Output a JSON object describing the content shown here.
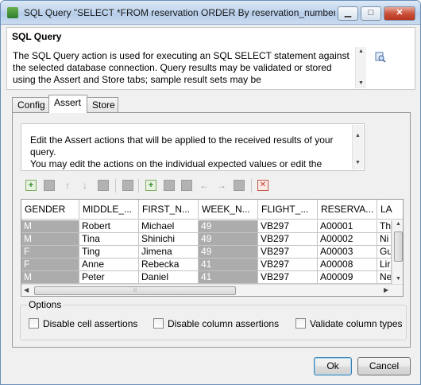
{
  "window": {
    "title": "SQL Query \"SELECT *FROM reservation  ORDER By reservation_number\" ...",
    "minimize_label": "▁",
    "maximize_label": "□",
    "close_label": "✕"
  },
  "header": {
    "title": "SQL Query",
    "description": "The SQL Query action is used for executing an SQL SELECT statement against the selected database connection. Query results may be validated or stored using the Assert and Store tabs; sample result sets may be"
  },
  "tabs": [
    {
      "label": "Config",
      "active": false
    },
    {
      "label": "Assert",
      "active": true
    },
    {
      "label": "Store",
      "active": false
    }
  ],
  "assert_panel": {
    "info": "Edit the Assert actions that will be applied to the received results of your query.\nYou may edit the actions on the individual expected values or edit the"
  },
  "toolbar": {
    "buttons": [
      "add-row-icon",
      "assert-icon",
      "move-up-icon",
      "move-down-icon",
      "assert-icon",
      "assert-icon",
      "add-column-icon",
      "assert-icon",
      "assert-icon",
      "move-left-icon",
      "move-right-icon",
      "assert-icon",
      "clear-icon"
    ]
  },
  "grid": {
    "columns": [
      "GENDER",
      "MIDDLE_...",
      "FIRST_N...",
      "WEEK_N...",
      "FLIGHT_...",
      "RESERVA...",
      "LA"
    ],
    "rows": [
      [
        "M",
        "Robert",
        "Michael",
        "49",
        "VB297",
        "A00001",
        "Th"
      ],
      [
        "M",
        "Tina",
        "Shinichi",
        "49",
        "VB297",
        "A00002",
        "Ni"
      ],
      [
        "F",
        "Ting",
        "Jimena",
        "49",
        "VB297",
        "A00003",
        "Gu"
      ],
      [
        "F",
        "Anne",
        "Rebecka",
        "41",
        "VB297",
        "A00008",
        "Lir"
      ],
      [
        "M",
        "Peter",
        "Daniel",
        "41",
        "VB297",
        "A00009",
        "Ne"
      ]
    ],
    "hscroll_grip": "⦙⦙⦙"
  },
  "options": {
    "legend": "Options",
    "disable_cell": "Disable cell assertions",
    "disable_column": "Disable column assertions",
    "validate_types": "Validate column types"
  },
  "footer": {
    "ok_label": "Ok",
    "cancel_label": "Cancel"
  }
}
